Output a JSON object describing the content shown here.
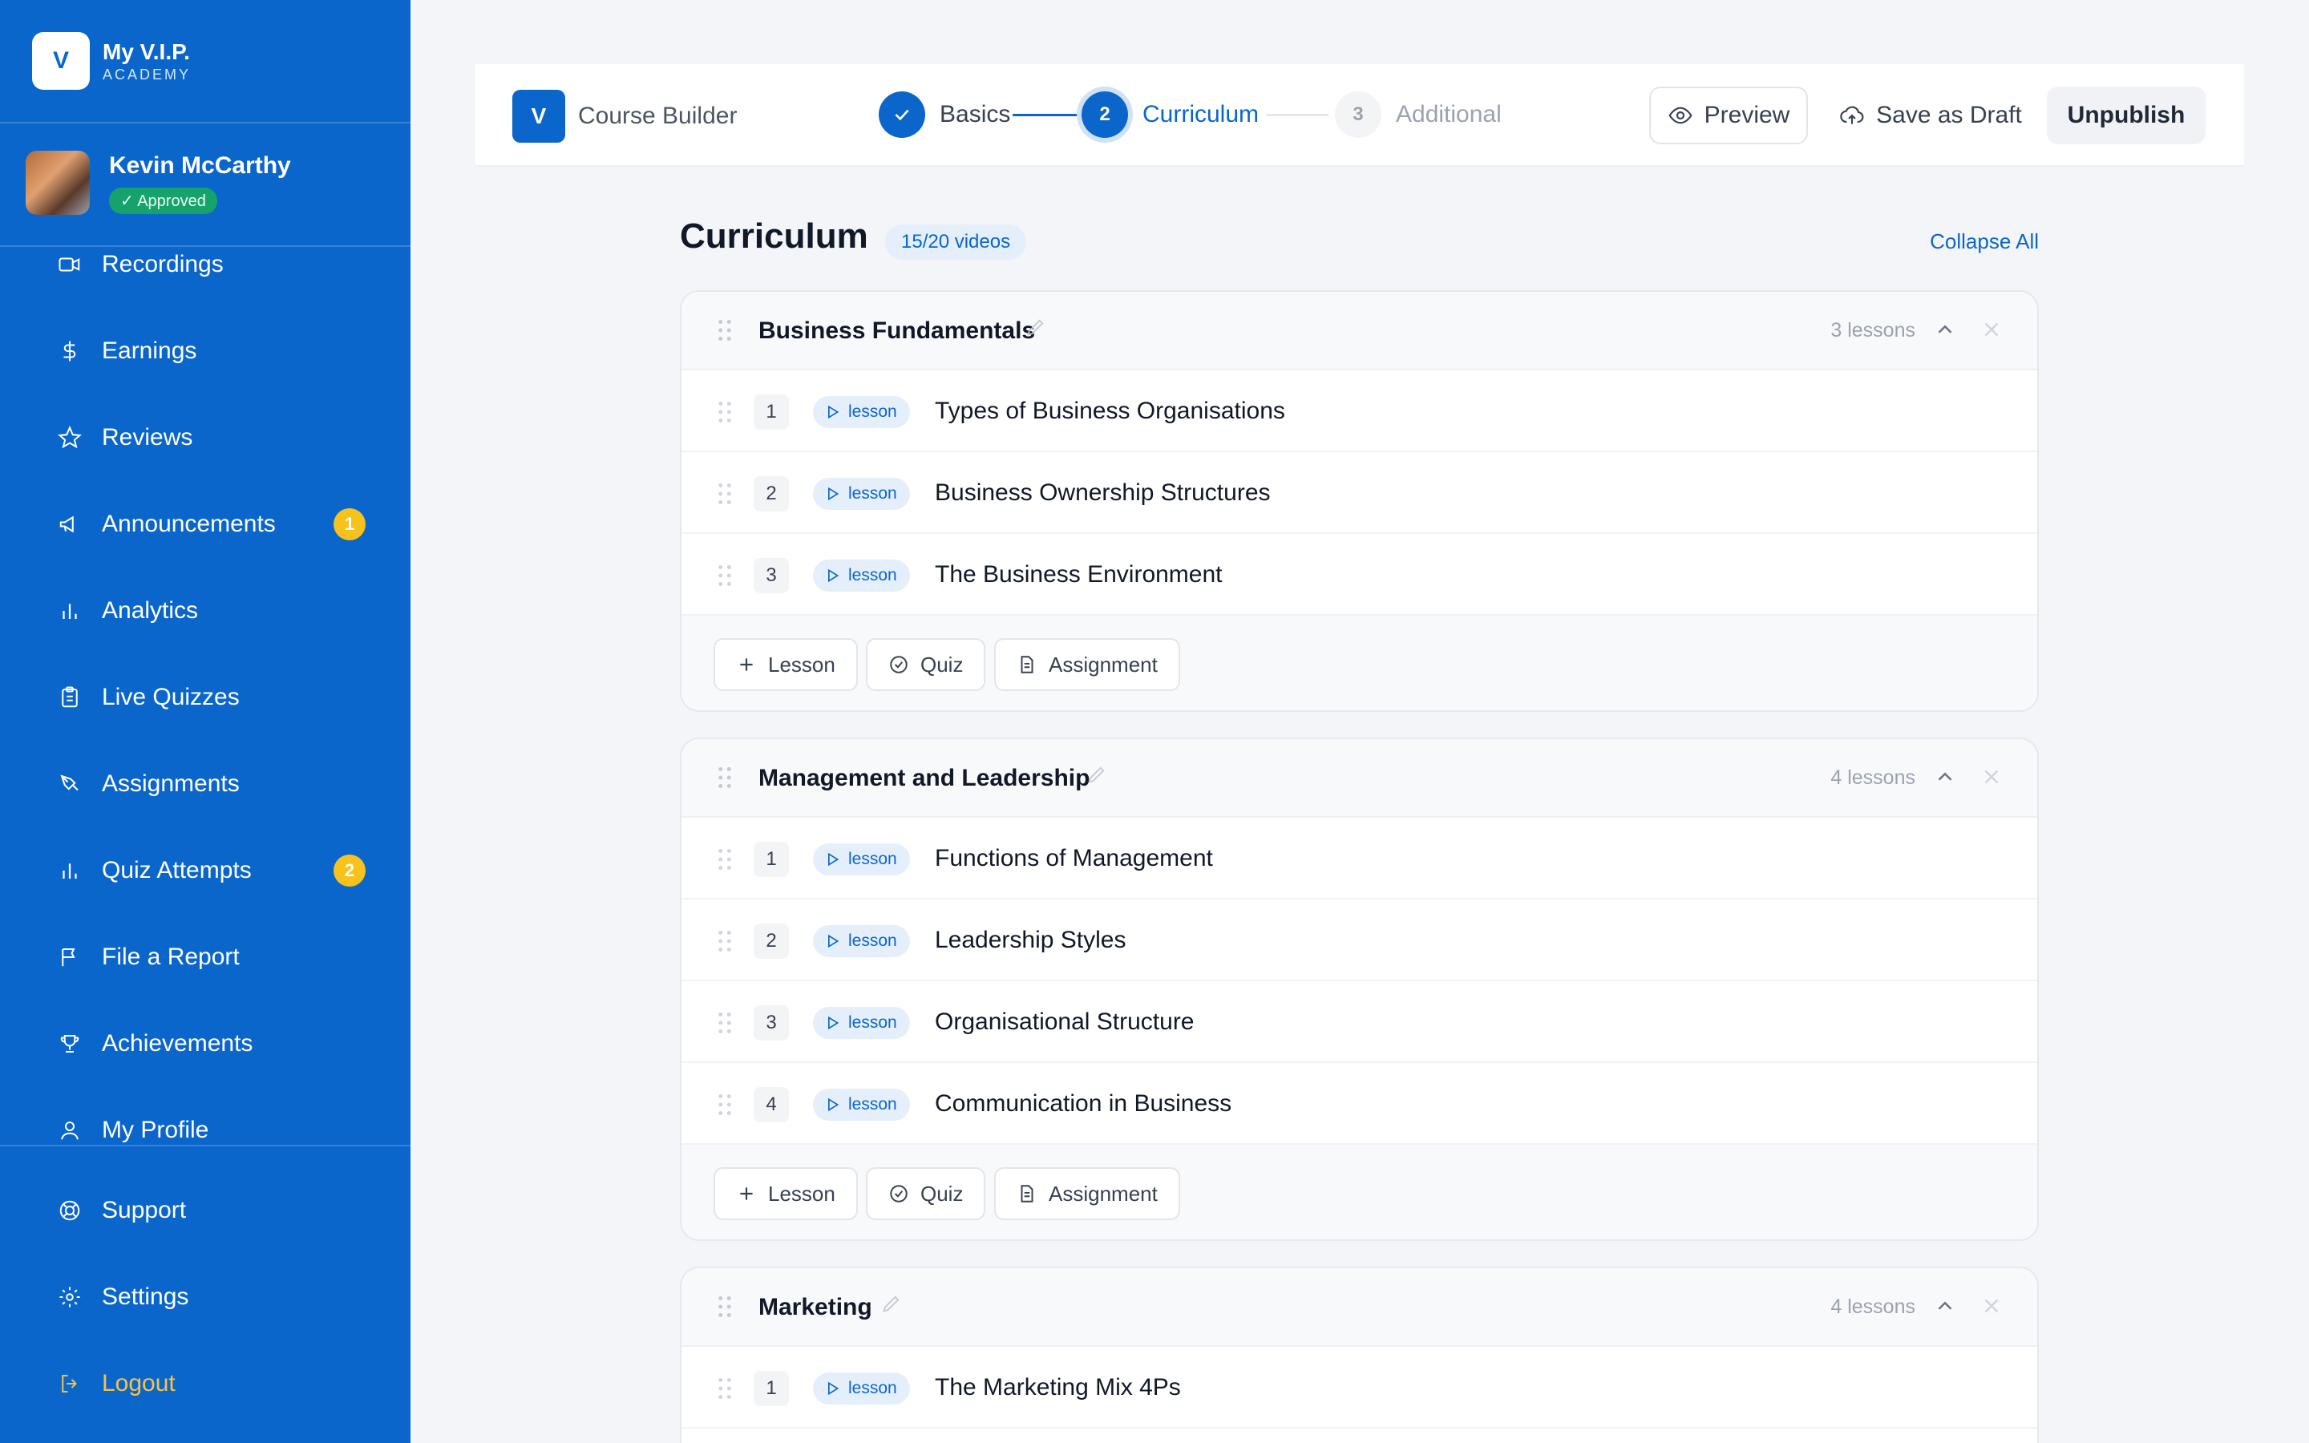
{
  "brand": {
    "logo_letter": "V",
    "name": "My V.I.P.",
    "sub": "ACADEMY"
  },
  "user": {
    "name": "Kevin McCarthy",
    "status": "✓ Approved"
  },
  "nav": [
    {
      "label": "Recordings",
      "icon": "video-icon"
    },
    {
      "label": "Earnings",
      "icon": "dollar-icon"
    },
    {
      "label": "Reviews",
      "icon": "star-icon"
    },
    {
      "label": "Announcements",
      "icon": "megaphone-icon",
      "count": "1"
    },
    {
      "label": "Analytics",
      "icon": "bar-chart-icon"
    },
    {
      "label": "Live Quizzes",
      "icon": "clipboard-icon"
    },
    {
      "label": "Assignments",
      "icon": "pen-tool-icon"
    },
    {
      "label": "Quiz Attempts",
      "icon": "bar-chart-icon",
      "count": "2"
    },
    {
      "label": "File a Report",
      "icon": "flag-icon"
    },
    {
      "label": "Achievements",
      "icon": "trophy-icon"
    },
    {
      "label": "My Profile",
      "icon": "user-icon"
    }
  ],
  "nav_bottom": [
    {
      "label": "Support",
      "icon": "lifebuoy-icon"
    },
    {
      "label": "Settings",
      "icon": "gear-icon"
    },
    {
      "label": "Logout",
      "icon": "logout-icon"
    }
  ],
  "topbar": {
    "logo_letter": "V",
    "title": "Course Builder",
    "steps": [
      {
        "number": "1",
        "label": "Basics",
        "state": "done"
      },
      {
        "number": "2",
        "label": "Curriculum",
        "state": "active"
      },
      {
        "number": "3",
        "label": "Additional",
        "state": "upcoming"
      }
    ],
    "preview_label": "Preview",
    "draft_label": "Save as Draft",
    "unpublish_label": "Unpublish"
  },
  "curriculum": {
    "title": "Curriculum",
    "count": "15/20 videos",
    "collapse_all": "Collapse All",
    "tag_label": "lesson",
    "add_buttons": {
      "lesson": "Lesson",
      "quiz": "Quiz",
      "assignment": "Assignment"
    },
    "sections": [
      {
        "title": "Business Fundamentals",
        "lesson_count": "3 lessons",
        "lessons": [
          {
            "num": "1",
            "title": "Types of Business Organisations"
          },
          {
            "num": "2",
            "title": "Business Ownership Structures"
          },
          {
            "num": "3",
            "title": "The Business Environment"
          }
        ]
      },
      {
        "title": "Management and Leadership",
        "lesson_count": "4 lessons",
        "lessons": [
          {
            "num": "1",
            "title": "Functions of Management"
          },
          {
            "num": "2",
            "title": "Leadership Styles"
          },
          {
            "num": "3",
            "title": "Organisational Structure"
          },
          {
            "num": "4",
            "title": "Communication in Business"
          }
        ]
      },
      {
        "title": "Marketing",
        "lesson_count": "4 lessons",
        "lessons": [
          {
            "num": "1",
            "title": "The Marketing Mix 4Ps"
          }
        ]
      }
    ]
  },
  "colors": {
    "primary": "#0b66cc",
    "sidebar_bg": "#0b66cc",
    "badge_yellow": "#f7c21b",
    "approved_green": "#15a36b",
    "logout_text": "#f6c343"
  }
}
